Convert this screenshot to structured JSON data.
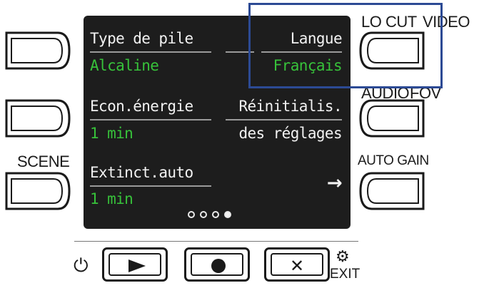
{
  "side_labels": {
    "lo_cut": "LO CUT",
    "video": "VIDEO",
    "audio": "AUDIO",
    "fov": "FOV",
    "scene": "SCENE",
    "auto_gain": "AUTO GAIN"
  },
  "menu": {
    "battery_type": {
      "label": "Type de pile",
      "value": "Alcaline"
    },
    "language": {
      "label": "Langue",
      "value": "Français"
    },
    "power_saving": {
      "label": "Econ.énergie",
      "value": "1 min"
    },
    "reset": {
      "label": "Réinitialis.",
      "subtitle": "des réglages"
    },
    "auto_off": {
      "label": "Extinct.auto",
      "value": "1 min"
    },
    "next_arrow": "→"
  },
  "pagination": {
    "total_pages": 4,
    "current_page": 4
  },
  "bottom_buttons": {
    "power_icon": "⏻",
    "play_icon": "play-icon",
    "record_icon": "record-icon",
    "close_icon": "✕",
    "gear_icon": "⚙",
    "exit_label": "EXIT"
  },
  "colors": {
    "screen_bg": "#1d1d1d",
    "value_green": "#37c23a",
    "highlight_blue": "#2c4a94"
  }
}
